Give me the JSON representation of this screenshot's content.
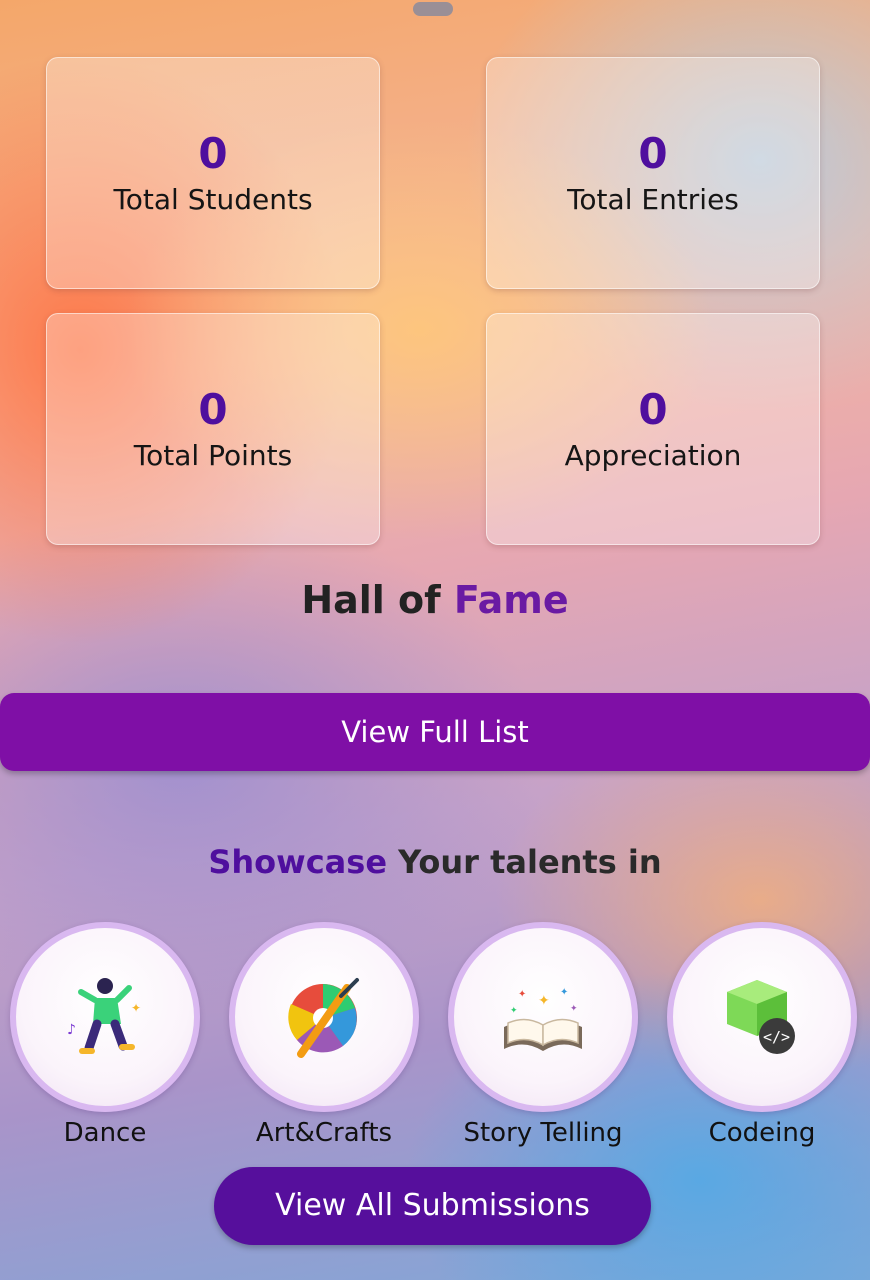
{
  "stats": [
    {
      "value": "0",
      "label": "Total Students"
    },
    {
      "value": "0",
      "label": "Total Entries"
    },
    {
      "value": "0",
      "label": "Total Points"
    },
    {
      "value": "0",
      "label": "Appreciation"
    }
  ],
  "hall_of_fame": {
    "title_main": "Hall of ",
    "title_accent": "Fame",
    "button_label": "View Full List"
  },
  "showcase": {
    "title_accent": "Showcase",
    "title_rest": " Your talents in",
    "categories": [
      {
        "label": "Dance",
        "icon": "dancer-icon"
      },
      {
        "label": "Art&Crafts",
        "icon": "palette-brush-icon"
      },
      {
        "label": "Story Telling",
        "icon": "open-book-icon"
      },
      {
        "label": "Codeing",
        "icon": "code-cube-icon"
      }
    ],
    "button_label": "View All Submissions"
  },
  "colors": {
    "accent": "#4f0f9e",
    "button": "#7f0fa6",
    "button_dark": "#560f9c"
  }
}
